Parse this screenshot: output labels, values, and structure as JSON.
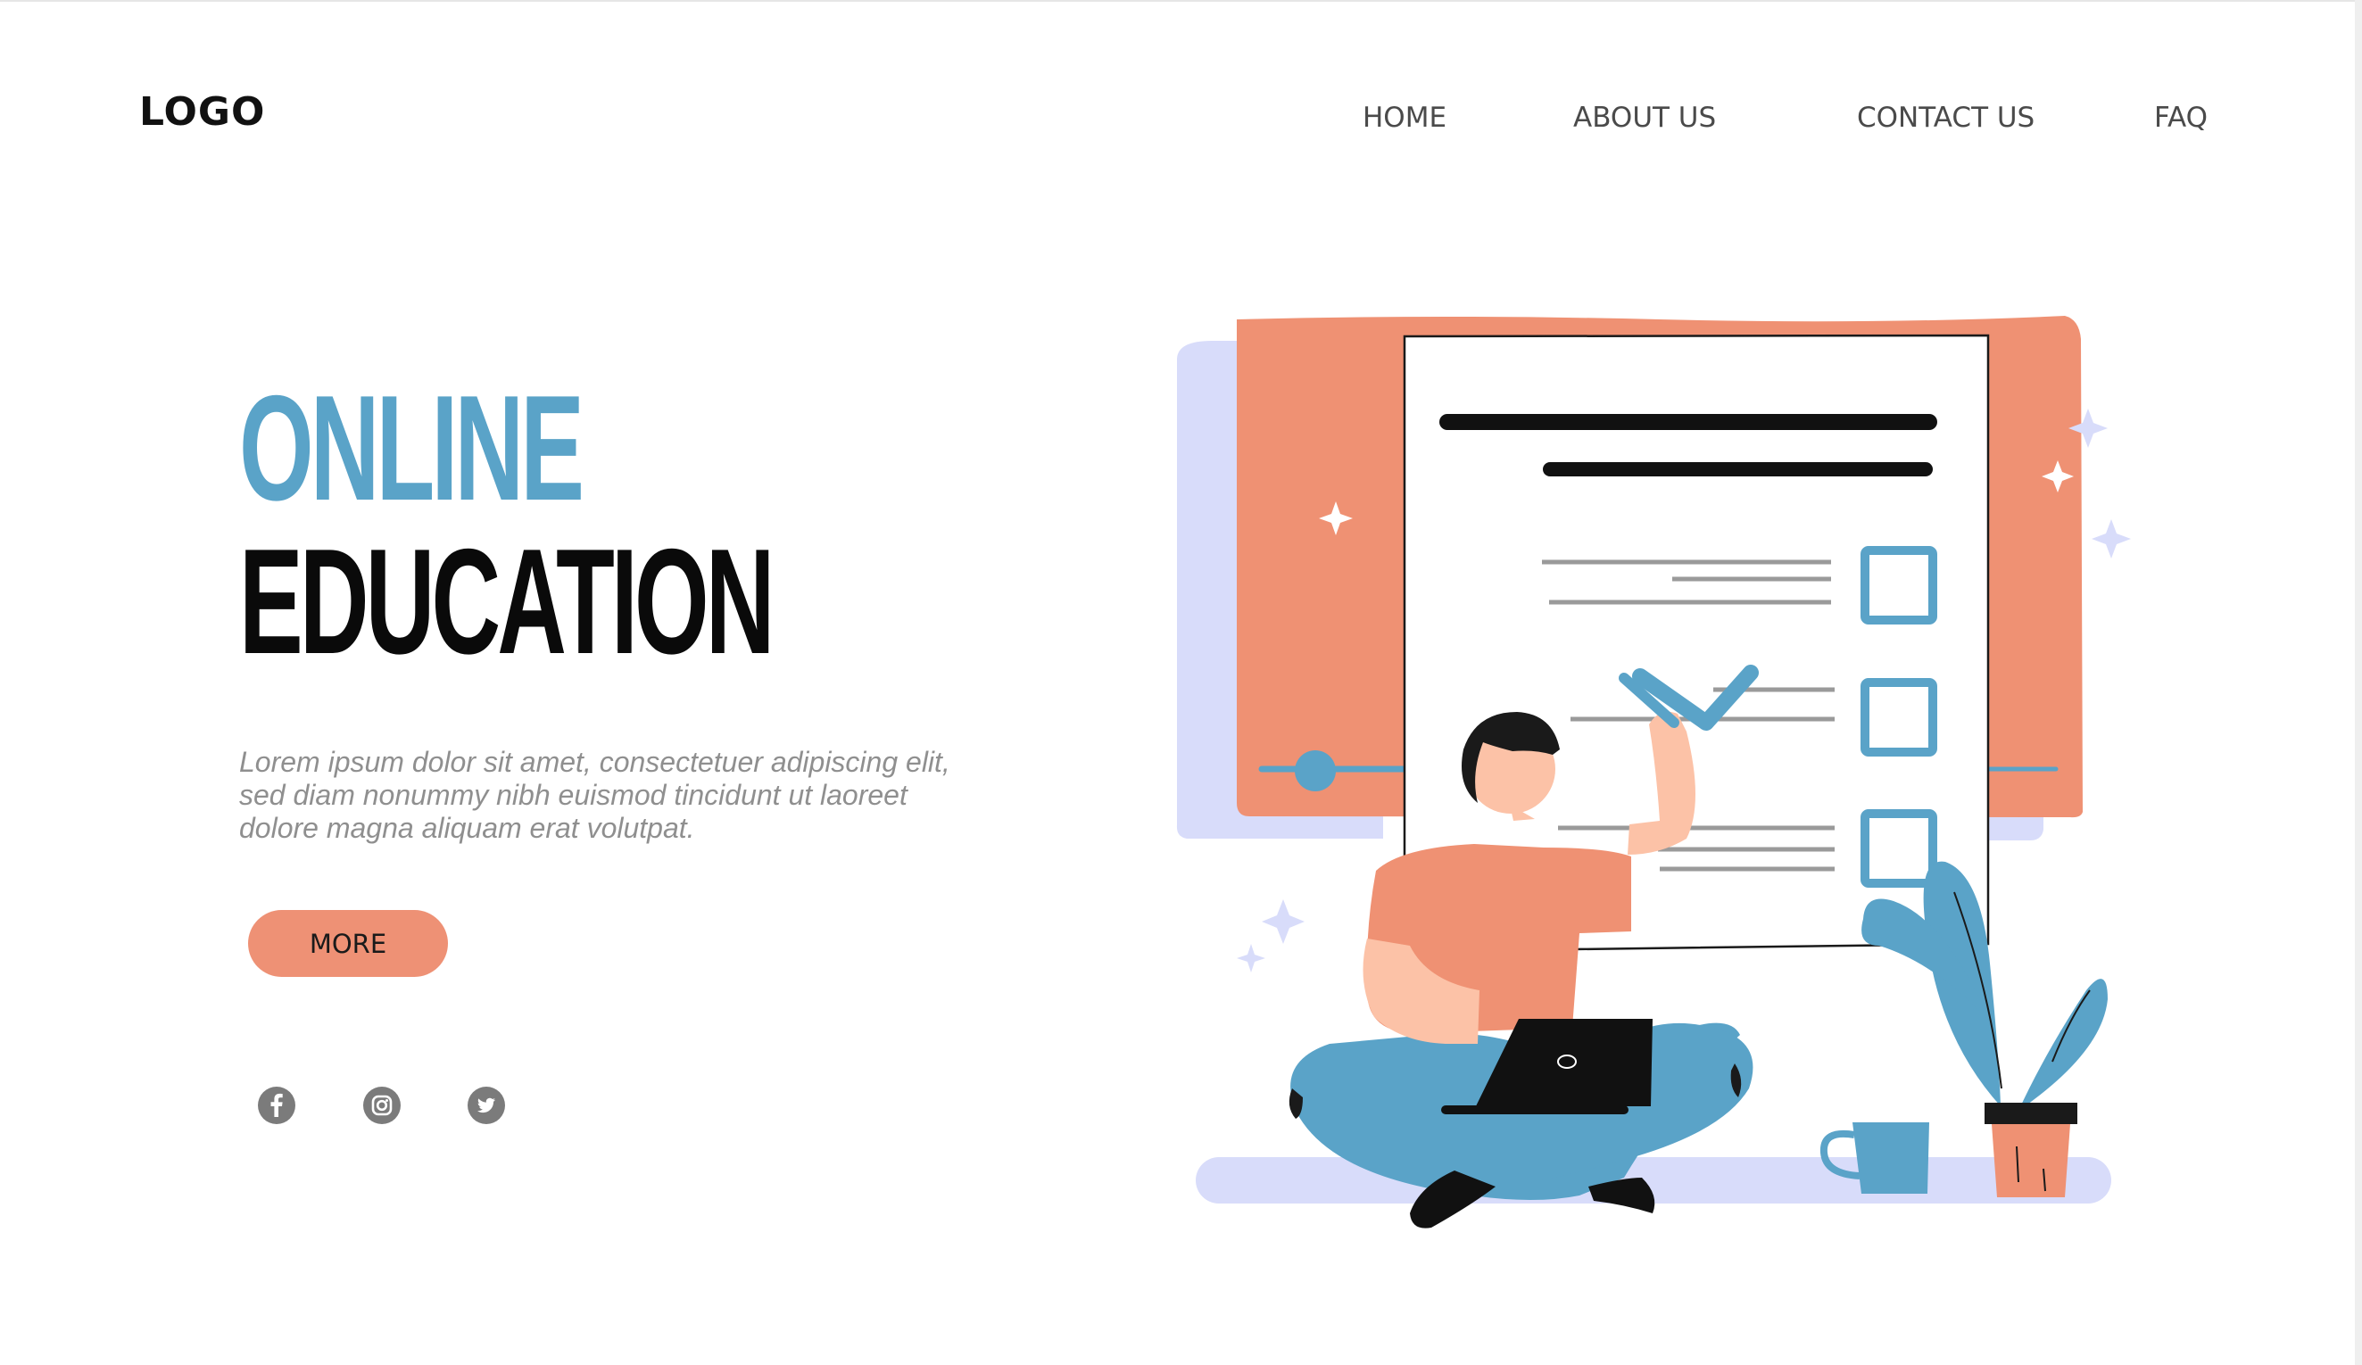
{
  "header": {
    "logo": "LOGO",
    "nav": [
      {
        "label": "HOME"
      },
      {
        "label": "ABOUT US"
      },
      {
        "label": "CONTACT US"
      },
      {
        "label": "FAQ"
      }
    ]
  },
  "hero": {
    "title_line1": "ONLINE",
    "title_line2": "EDUCATION",
    "description": "Lorem ipsum dolor sit amet, consectetuer adipiscing elit, sed diam nonummy nibh euismod tincidunt ut laoreet dolore magna aliquam erat volutpat.",
    "more_label": "MORE"
  },
  "social": [
    {
      "icon": "facebook-icon"
    },
    {
      "icon": "instagram-icon"
    },
    {
      "icon": "twitter-icon"
    }
  ],
  "colors": {
    "accent_blue": "#5aa3c8",
    "accent_coral": "#ee9175",
    "lavender": "#d8dcfa",
    "text_dark": "#0a0a0a",
    "text_muted": "#8f8f8f"
  }
}
